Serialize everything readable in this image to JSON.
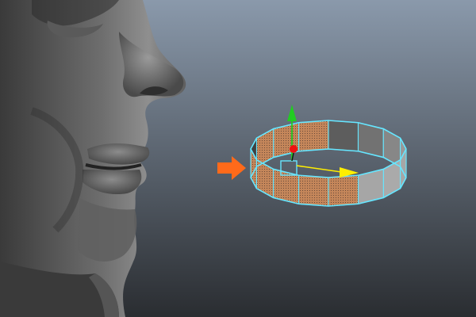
{
  "viewport": {
    "background_top": "#8a99ab",
    "background_bottom": "#2a2d31"
  },
  "head_model": {
    "kind": "3d-head-bust",
    "shade_light": "#8f8f8f",
    "shade_dark": "#2a2a2a"
  },
  "ring_object": {
    "kind": "polygon-ring",
    "selected": true,
    "wireframe_color": "#66e6ff",
    "face_light": "#b7b7b7",
    "face_dark": "#3c3c3c",
    "selected_faces_color": "#c4865a"
  },
  "gizmo": {
    "y_axis_color": "#22cc22",
    "x_axis_color": "#ffee00",
    "z_handle_color": "#ee1111",
    "center_box_color": "#66e6ff"
  },
  "pointer": {
    "icon": "arrow-right-icon",
    "color": "#ff6a1a"
  }
}
